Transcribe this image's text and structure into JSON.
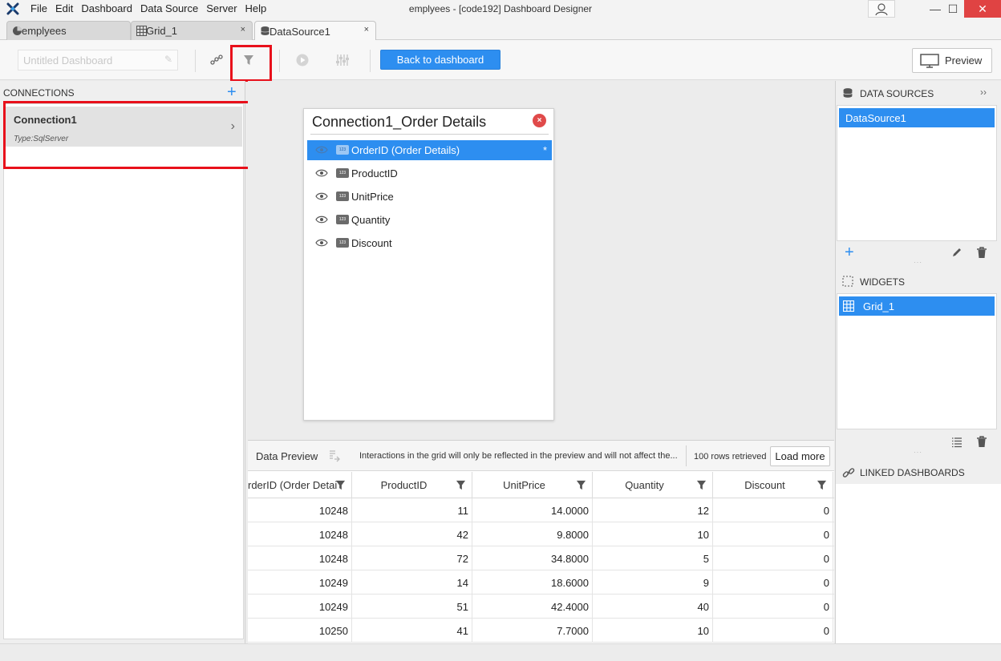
{
  "window": {
    "title": "emplyees - [code192] Dashboard Designer",
    "menu": [
      "File",
      "Edit",
      "Dashboard",
      "Data Source",
      "Server",
      "Help"
    ],
    "controls": {
      "minimize": "—",
      "maximize": "☐",
      "close": "✕"
    }
  },
  "tabs": [
    {
      "label": "emplyees",
      "icon": "dashboard-icon",
      "close": ""
    },
    {
      "label": "Grid_1",
      "icon": "grid-icon",
      "close": "×"
    },
    {
      "label": "DataSource1",
      "icon": "database-icon",
      "close": "×"
    }
  ],
  "toolbar": {
    "dashboard_name_placeholder": "Untitled Dashboard",
    "back_label": "Back to dashboard",
    "preview_label": "Preview"
  },
  "connections": {
    "header": "CONNECTIONS",
    "add": "+",
    "items": [
      {
        "name": "Connection1",
        "type": "Type:SqlServer"
      }
    ]
  },
  "table_card": {
    "title": "Connection1_Order Details",
    "close": "×",
    "columns": [
      {
        "label": "OrderID (Order Details)",
        "type_badge": "123",
        "marker": "*"
      },
      {
        "label": "ProductID",
        "type_badge": "123",
        "marker": ""
      },
      {
        "label": "UnitPrice",
        "type_badge": "123",
        "marker": ""
      },
      {
        "label": "Quantity",
        "type_badge": "123",
        "marker": ""
      },
      {
        "label": "Discount",
        "type_badge": "123",
        "marker": ""
      }
    ]
  },
  "data_preview": {
    "title": "Data Preview",
    "note": "Interactions in the grid will only be reflected in the preview and will not affect the...",
    "rows_retrieved": "100 rows retrieved",
    "load_more": "Load more",
    "headers": [
      "rderID (Order Detai",
      "ProductID",
      "UnitPrice",
      "Quantity",
      "Discount"
    ],
    "rows": [
      [
        "10248",
        "11",
        "14.0000",
        "12",
        "0"
      ],
      [
        "10248",
        "42",
        "9.8000",
        "10",
        "0"
      ],
      [
        "10248",
        "72",
        "34.8000",
        "5",
        "0"
      ],
      [
        "10249",
        "14",
        "18.6000",
        "9",
        "0"
      ],
      [
        "10249",
        "51",
        "42.4000",
        "40",
        "0"
      ],
      [
        "10250",
        "41",
        "7.7000",
        "10",
        "0"
      ]
    ]
  },
  "right_panel": {
    "data_sources": {
      "header": "DATA SOURCES",
      "collapse": "››",
      "items": [
        "DataSource1"
      ]
    },
    "widgets": {
      "header": "WIDGETS",
      "items": [
        "Grid_1"
      ]
    },
    "linked": {
      "header": "LINKED DASHBOARDS"
    }
  },
  "colors": {
    "accent": "#2d8ef0",
    "highlight": "#e8101b",
    "close_red": "#e04343"
  }
}
